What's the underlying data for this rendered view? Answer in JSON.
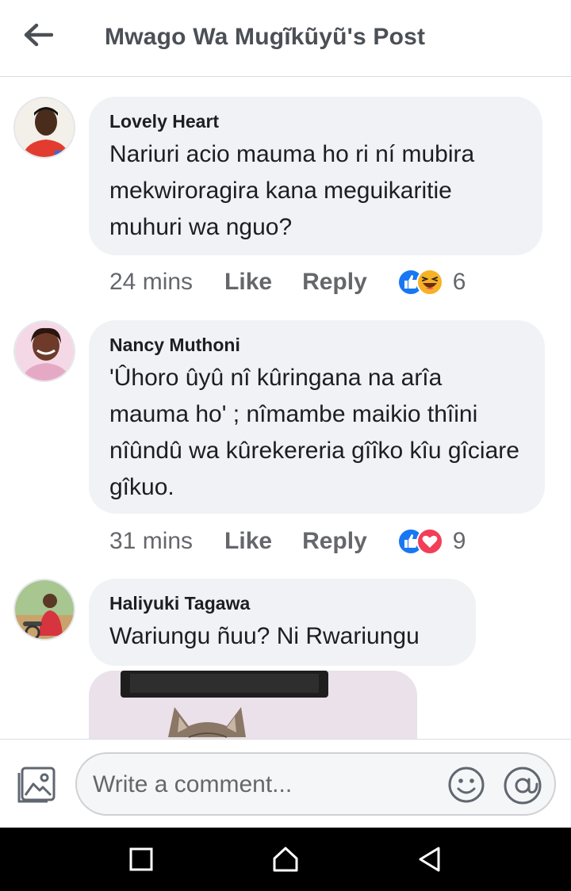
{
  "header": {
    "title": "Mwago Wa Mugĩkũyũ's Post",
    "back_icon": "arrow-left-icon"
  },
  "comments": [
    {
      "author": "Lovely Heart",
      "text": "Nariuri acio mauma ho ri ní mubira mekwiroragira kana meguikaritie muhuri wa nguo?",
      "time": "24 mins",
      "like_label": "Like",
      "reply_label": "Reply",
      "reactions": [
        "like-icon",
        "haha-icon"
      ],
      "reaction_count": "6"
    },
    {
      "author": "Nancy Muthoni",
      "text": "'Ûhoro ûyû nî kûringana na arîa mauma ho' ; nîmambe maikio thîini nîûndû wa kûrekereria gîîko kîu gîciare gîkuo.",
      "time": "31 mins",
      "like_label": "Like",
      "reply_label": "Reply",
      "reactions": [
        "like-icon",
        "love-icon"
      ],
      "reaction_count": "9"
    },
    {
      "author": "Haliyuki Tagawa",
      "text": "Wariungu ñuu? Ni Rwariungu"
    }
  ],
  "composer": {
    "placeholder": "Write a comment...",
    "photo_icon": "photo-icon",
    "emoji_icon": "emoji-icon",
    "mention_icon": "at-icon"
  },
  "navbar": {
    "icons": [
      "recent-apps-icon",
      "home-icon",
      "back-icon"
    ]
  },
  "colors": {
    "like_blue": "#1877f2",
    "love_red": "#f33e58",
    "haha_yellow": "#f7b125",
    "bubble_bg": "#f0f2f5"
  }
}
